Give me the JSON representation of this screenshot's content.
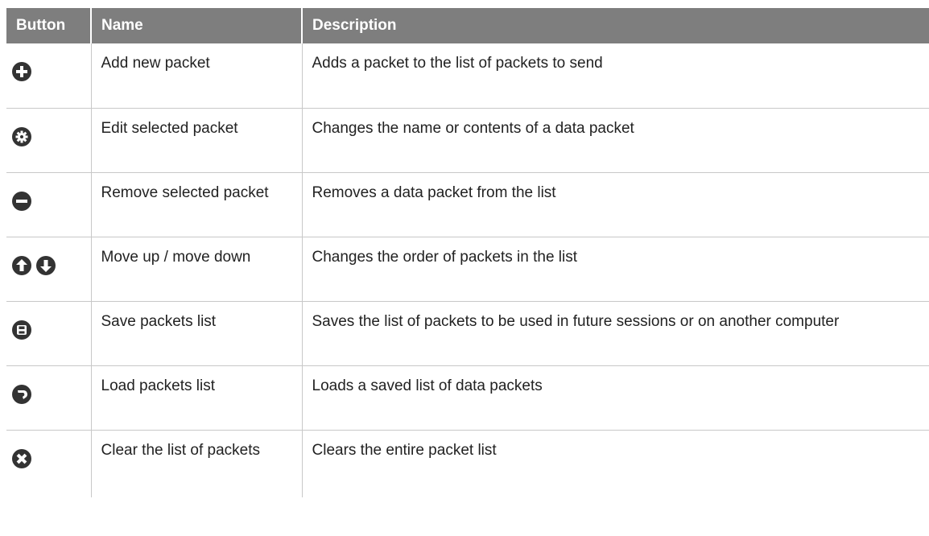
{
  "header": {
    "col_button": "Button",
    "col_name": "Name",
    "col_description": "Description"
  },
  "rows": [
    {
      "icon": "add-icon",
      "name": "Add new packet",
      "description": "Adds a packet to the list of packets to send"
    },
    {
      "icon": "gear-icon",
      "name": "Edit selected packet",
      "description": "Changes the name or contents of a data packet"
    },
    {
      "icon": "remove-icon",
      "name": "Remove selected packet",
      "description": "Removes a data packet from the list"
    },
    {
      "icon": [
        "arrow-up-icon",
        "arrow-down-icon"
      ],
      "name": "Move up / move down",
      "description": "Changes the order of packets in the list"
    },
    {
      "icon": "save-icon",
      "name": "Save packets list",
      "description": "Saves the list of packets to be used in future sessions or on another computer"
    },
    {
      "icon": "load-icon",
      "name": "Load packets list",
      "description": "Loads a saved list of data packets"
    },
    {
      "icon": "clear-icon",
      "name": "Clear the list of packets",
      "description": "Clears the entire packet list"
    }
  ],
  "colors": {
    "header_bg": "#7e7e7e",
    "header_text": "#ffffff",
    "icon_fill": "#333333",
    "grid_line": "#c8c8c8"
  }
}
